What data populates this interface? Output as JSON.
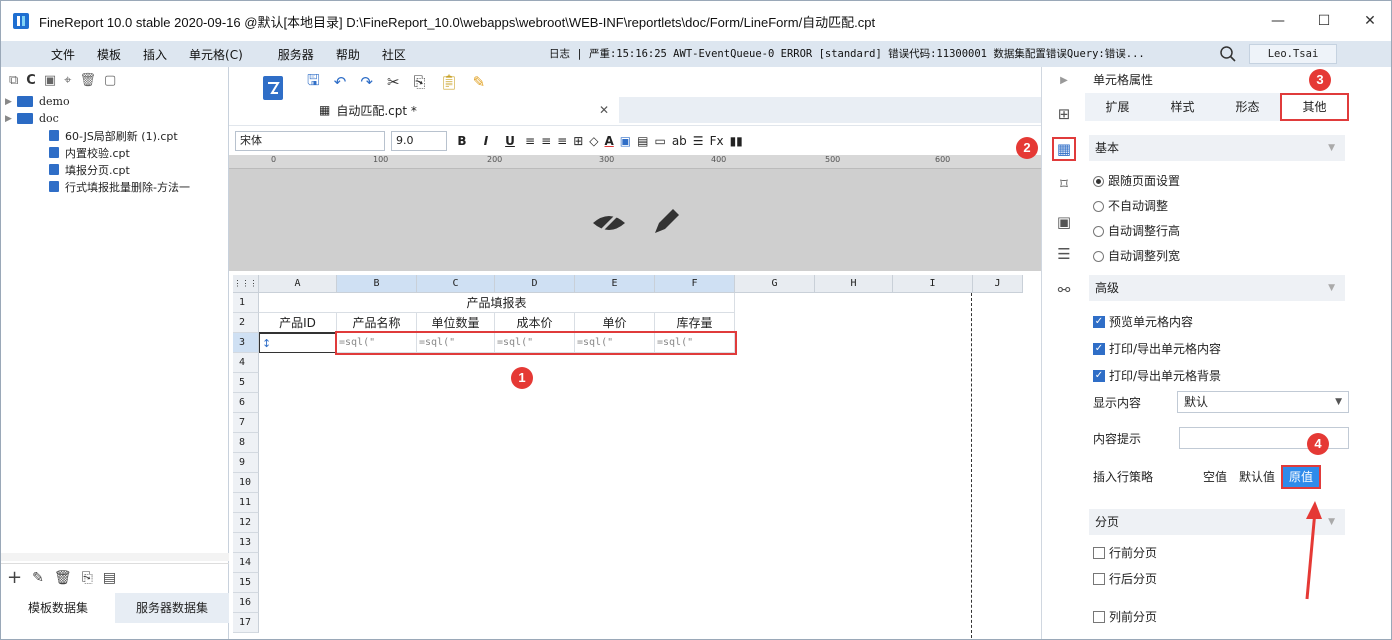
{
  "titlebar": {
    "title": "FineReport 10.0 stable 2020-09-16 @默认[本地目录]    D:\\FineReport_10.0\\webapps\\webroot\\WEB-INF\\reportlets\\doc/Form/LineForm/自动匹配.cpt",
    "minimize": "—",
    "maximize": "☐",
    "close": "✕"
  },
  "menubar": {
    "items": [
      "文件",
      "模板",
      "插入",
      "单元格(C)",
      "服务器",
      "帮助",
      "社区"
    ],
    "log": "日志 | 严重:15:16:25 AWT-EventQueue-0 ERROR [standard] 错误代码:11300001 数据集配置错误Query:错误...",
    "user": "Leo.Tsai"
  },
  "left_panel": {
    "tree": [
      {
        "type": "folder",
        "label": "demo"
      },
      {
        "type": "folder",
        "label": "doc"
      },
      {
        "type": "file",
        "label": "60-JS局部刷新 (1).cpt"
      },
      {
        "type": "file",
        "label": "内置校验.cpt"
      },
      {
        "type": "file",
        "label": "填报分页.cpt"
      },
      {
        "type": "file",
        "label": "行式填报批量删除-方法一"
      }
    ],
    "tabs": [
      "模板数据集",
      "服务器数据集"
    ]
  },
  "editor": {
    "doc_tab": "自动匹配.cpt *",
    "font_name": "宋体",
    "font_size": "9.0",
    "ruler_ticks": [
      "0",
      "100",
      "200",
      "300",
      "400",
      "500",
      "600"
    ],
    "columns": [
      "A",
      "B",
      "C",
      "D",
      "E",
      "F",
      "G",
      "H",
      "I",
      "J"
    ],
    "rows": [
      "1",
      "2",
      "3",
      "4",
      "5",
      "6",
      "7",
      "8",
      "9",
      "10",
      "11",
      "12",
      "13",
      "14",
      "15",
      "16",
      "17"
    ],
    "sheet_title": "产品填报表",
    "headers": [
      "产品ID",
      "产品名称",
      "单位数量",
      "成本价",
      "单价",
      "库存量"
    ],
    "formula": "=sql(\""
  },
  "badges": [
    "1",
    "2",
    "3",
    "4"
  ],
  "right_panel": {
    "title": "单元格属性",
    "tabs": [
      "扩展",
      "样式",
      "形态",
      "其他"
    ],
    "basic": {
      "header": "基本",
      "options": [
        "跟随页面设置",
        "不自动调整",
        "自动调整行高",
        "自动调整列宽"
      ]
    },
    "advanced": {
      "header": "高级",
      "checks": [
        "预览单元格内容",
        "打印/导出单元格内容",
        "打印/导出单元格背景"
      ],
      "display_label": "显示内容",
      "display_value": "默认",
      "tip_label": "内容提示",
      "insert_label": "插入行策略",
      "insert_options": [
        "空值",
        "默认值",
        "原值"
      ]
    },
    "paging": {
      "header": "分页",
      "checks": [
        "行前分页",
        "行后分页",
        "列前分页"
      ]
    }
  },
  "colors": {
    "accent": "#2f8bea",
    "highlight": "#e03b3b",
    "menubar": "#dde6f0"
  }
}
